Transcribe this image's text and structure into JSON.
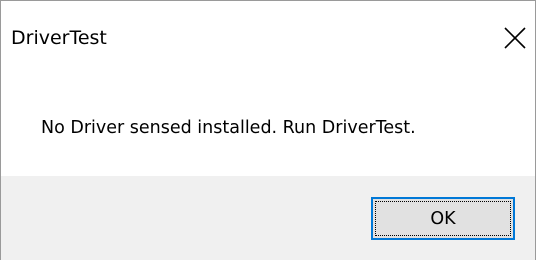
{
  "window": {
    "title": "DriverTest",
    "close_icon": "close-icon"
  },
  "dialog": {
    "message": "No Driver sensed installed. Run DriverTest.",
    "ok_label": "OK"
  },
  "colors": {
    "footer_bg": "#f0f0f0",
    "button_bg": "#e1e1e1",
    "button_focus_border": "#0078d7"
  }
}
